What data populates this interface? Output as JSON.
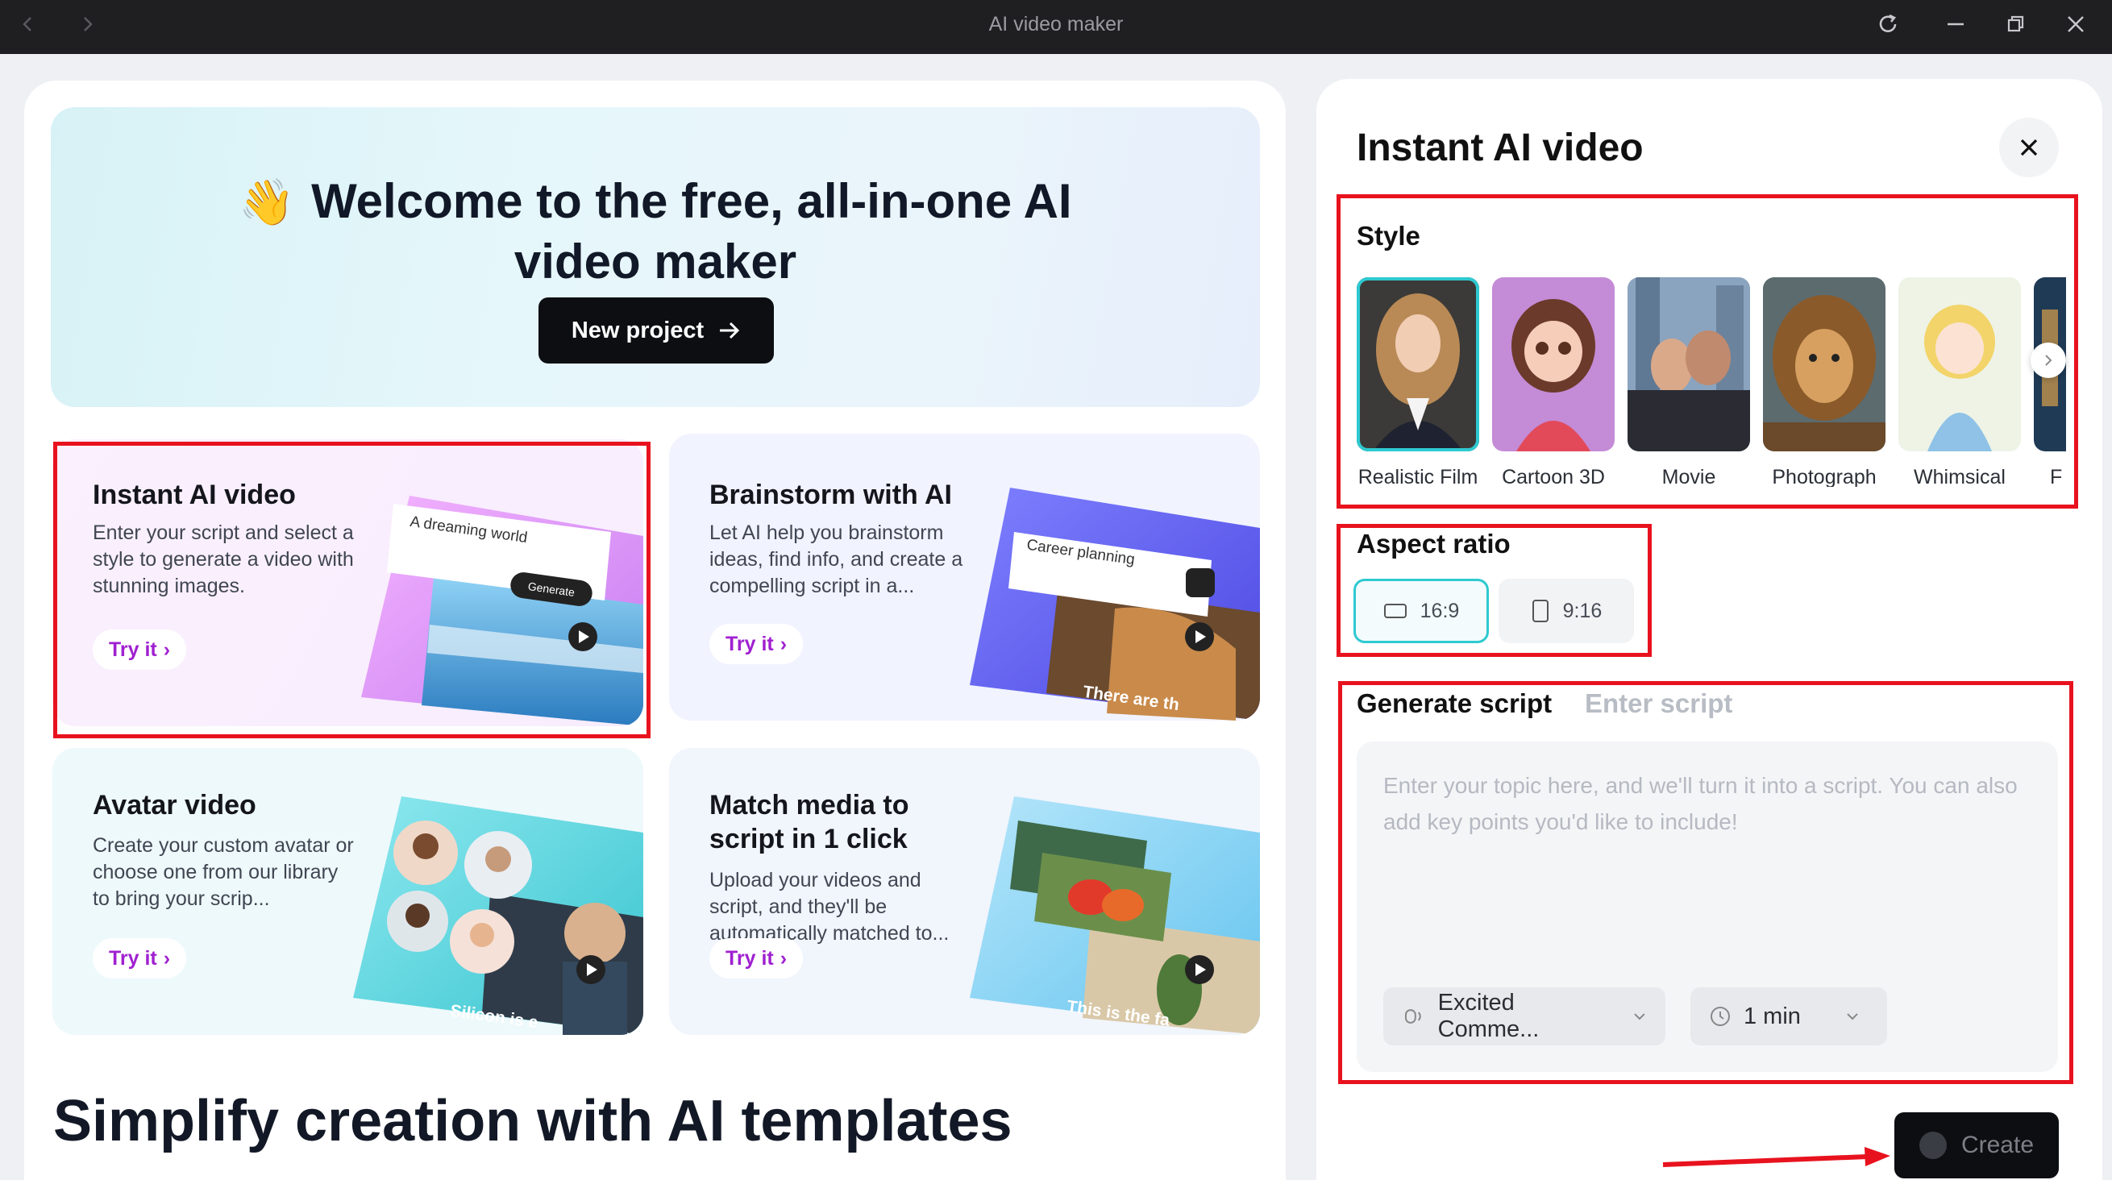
{
  "window": {
    "title": "AI video maker"
  },
  "banner": {
    "title": "Welcome to the free, all-in-one AI video maker",
    "new_project": "New project"
  },
  "cards": [
    {
      "title": "Instant AI video",
      "desc": "Enter your script and select a style to generate a video with stunning images.",
      "cta": "Try it",
      "art_caption": "A dreaming world",
      "art_button": "Generate"
    },
    {
      "title": "Brainstorm with AI",
      "desc": "Let AI help you brainstorm ideas, find info, and create a compelling script in a...",
      "cta": "Try it",
      "art_caption": "Career planning",
      "art_overlay": "There are th"
    },
    {
      "title": "Avatar video",
      "desc": "Create your custom avatar or choose one from our library to bring your scrip...",
      "cta": "Try it",
      "art_overlay": "Silicon is e"
    },
    {
      "title": "Match media to script in 1 click",
      "desc": "Upload your videos and script, and they'll be automatically matched to...",
      "cta": "Try it",
      "art_overlay": "This is the fa"
    }
  ],
  "section_title": "Simplify creation with AI templates",
  "panel": {
    "title": "Instant AI video",
    "style_label": "Style",
    "styles": [
      {
        "label": "Realistic Film",
        "selected": true
      },
      {
        "label": "Cartoon 3D",
        "selected": false
      },
      {
        "label": "Movie",
        "selected": false
      },
      {
        "label": "Photograph",
        "selected": false
      },
      {
        "label": "Whimsical",
        "selected": false
      },
      {
        "label": "F",
        "selected": false
      }
    ],
    "aspect_label": "Aspect ratio",
    "ratios": [
      {
        "label": "16:9",
        "selected": true
      },
      {
        "label": "9:16",
        "selected": false
      }
    ],
    "tabs": {
      "generate": "Generate script",
      "enter": "Enter script"
    },
    "script_placeholder": "Enter your topic here, and we'll turn it into a script. You can also add key points you'd like to include!",
    "voice": "Excited Comme...",
    "duration": "1 min",
    "create": "Create"
  },
  "colors": {
    "accent": "#2ec9d0",
    "cta": "#a020d0",
    "annotation": "#e8121e",
    "dark": "#0c0e12"
  }
}
